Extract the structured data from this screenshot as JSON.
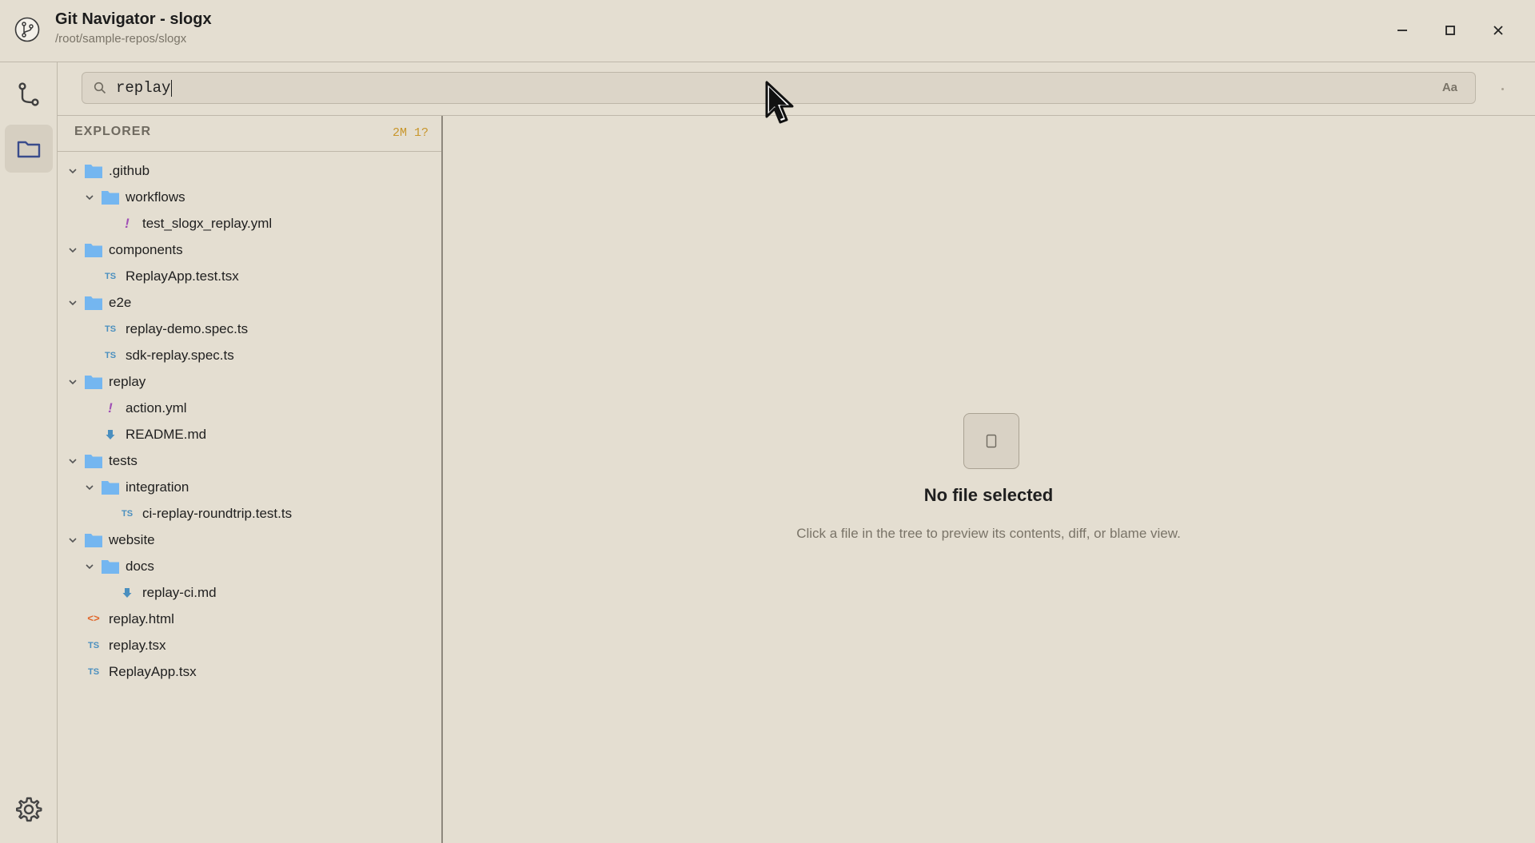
{
  "window": {
    "title": "Git Navigator - slogx",
    "path": "/root/sample-repos/slogx",
    "controls": [
      "minimize-icon",
      "maximize-icon",
      "close-icon"
    ]
  },
  "activity_bar": {
    "items": [
      {
        "icon": "git-branch-icon",
        "active": false
      },
      {
        "icon": "folder-icon",
        "active": true
      }
    ],
    "bottom": {
      "icon": "settings-gear-icon"
    }
  },
  "search": {
    "value": "replay",
    "case_toggle": "Aa"
  },
  "explorer": {
    "title": "EXPLORER",
    "status": "2M 1?",
    "tree": [
      {
        "label": ".github",
        "type": "folder",
        "depth": 0,
        "expanded": true
      },
      {
        "label": "workflows",
        "type": "folder",
        "depth": 1,
        "expanded": true
      },
      {
        "label": "test_slogx_replay.yml",
        "type": "yml",
        "depth": 2
      },
      {
        "label": "components",
        "type": "folder",
        "depth": 0,
        "expanded": true
      },
      {
        "label": "ReplayApp.test.tsx",
        "type": "ts",
        "depth": 1
      },
      {
        "label": "e2e",
        "type": "folder",
        "depth": 0,
        "expanded": true
      },
      {
        "label": "replay-demo.spec.ts",
        "type": "ts",
        "depth": 1
      },
      {
        "label": "sdk-replay.spec.ts",
        "type": "ts",
        "depth": 1
      },
      {
        "label": "replay",
        "type": "folder",
        "depth": 0,
        "expanded": true
      },
      {
        "label": "action.yml",
        "type": "yml",
        "depth": 1
      },
      {
        "label": "README.md",
        "type": "md",
        "depth": 1
      },
      {
        "label": "tests",
        "type": "folder",
        "depth": 0,
        "expanded": true
      },
      {
        "label": "integration",
        "type": "folder",
        "depth": 1,
        "expanded": true
      },
      {
        "label": "ci-replay-roundtrip.test.ts",
        "type": "ts",
        "depth": 2
      },
      {
        "label": "website",
        "type": "folder",
        "depth": 0,
        "expanded": true
      },
      {
        "label": "docs",
        "type": "folder",
        "depth": 1,
        "expanded": true
      },
      {
        "label": "replay-ci.md",
        "type": "md",
        "depth": 2
      },
      {
        "label": "replay.html",
        "type": "html",
        "depth": 0
      },
      {
        "label": "replay.tsx",
        "type": "ts",
        "depth": 0
      },
      {
        "label": "ReplayApp.tsx",
        "type": "ts",
        "depth": 0
      }
    ],
    "icon_text": {
      "ts": "TS",
      "yml": "!",
      "html": "<>"
    }
  },
  "preview": {
    "empty_title": "No file selected",
    "empty_subtitle": "Click a file in the tree to preview its contents, diff, or blame view."
  },
  "colors": {
    "background": "#e4ded1",
    "folder": "#74b6f0",
    "ts": "#4a8fbf",
    "yml": "#a04fb5",
    "html": "#e0662b",
    "md": "#4a8fbf",
    "status": "#c8962c"
  }
}
